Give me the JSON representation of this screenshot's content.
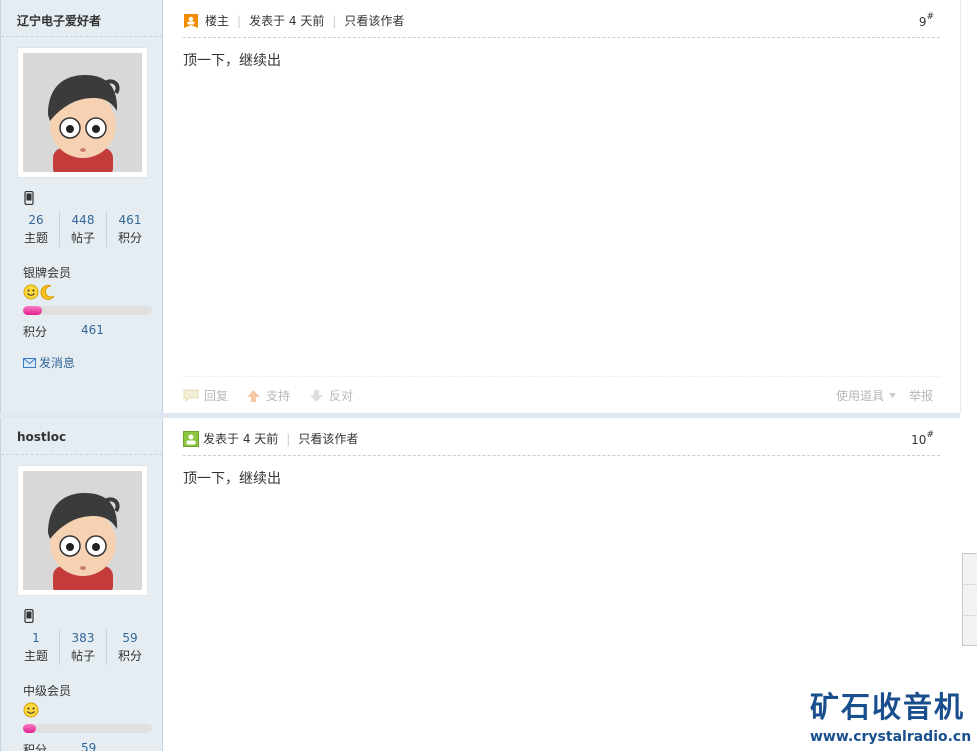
{
  "posts": [
    {
      "author": "辽宁电子爱好者",
      "stats": [
        {
          "value": "26",
          "label": "主题"
        },
        {
          "value": "448",
          "label": "帖子"
        },
        {
          "value": "461",
          "label": "积分"
        }
      ],
      "level": "银牌会员",
      "level_progress_percent": 15,
      "credit_label": "积分",
      "credit_value": "461",
      "send_message": "发消息",
      "is_op_badge": "楼主",
      "posted": "发表于 4 天前",
      "only_author": "只看该作者",
      "floor": "9",
      "floor_mark": "#",
      "body": "顶一下，继续出",
      "actions": {
        "reply": "回复",
        "support": "支持",
        "oppose": "反对",
        "tools": "使用道具",
        "report": "举报"
      }
    },
    {
      "author": "hostloc",
      "stats": [
        {
          "value": "1",
          "label": "主题"
        },
        {
          "value": "383",
          "label": "帖子"
        },
        {
          "value": "59",
          "label": "积分"
        }
      ],
      "level": "中级会员",
      "level_progress_percent": 10,
      "credit_label": "积分",
      "credit_value": "59",
      "posted": "发表于 4 天前",
      "only_author": "只看该作者",
      "floor": "10",
      "floor_mark": "#",
      "body": "顶一下，继续出"
    }
  ],
  "watermark": {
    "title": "矿石收音机",
    "url": "www.crystalradio.cn"
  }
}
